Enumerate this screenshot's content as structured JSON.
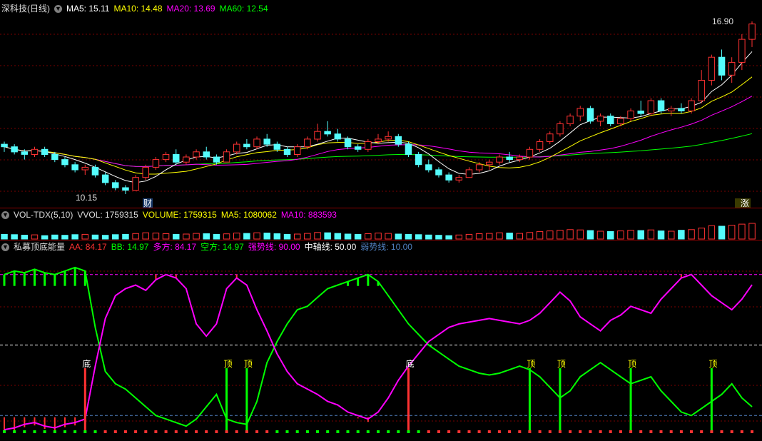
{
  "colors": {
    "up": "#ff3232",
    "down": "#54fcfc",
    "ma5": "#ffffff",
    "ma10": "#ffff00",
    "ma20": "#ff00ff",
    "ma60": "#00ff00",
    "aa": "#ff3232",
    "bb": "#00ff00",
    "duo": "#ff00ff",
    "kong": "#00ff00",
    "strong": "#ff00ff",
    "mid": "#ffffff",
    "weak": "#5080c0"
  },
  "price_panel": {
    "title": "深科技(日线)",
    "icon": "chevron-down-icon",
    "ma5_label": "MA5: 15.11",
    "ma10_label": "MA10: 14.48",
    "ma20_label": "MA20: 13.69",
    "ma60_label": "MA60: 12.54",
    "high_label": "16.90",
    "low_label": "10.15",
    "finance_badge": "财",
    "rise_badge": "涨"
  },
  "volume_panel": {
    "name": "VOL-TDX(5,10)",
    "vvol_label": "VVOL: 1759315",
    "volume_label": "VOLUME: 1759315",
    "ma5_label": "MA5: 1080062",
    "ma10_label": "MA10: 883593"
  },
  "indicator_panel": {
    "name": "私募顶底能量",
    "aa_label": "AA: 84.17",
    "bb_label": "BB: 14.97",
    "duo_label": "多方: 84.17",
    "kong_label": "空方: 14.97",
    "strong_label": "强势线: 90.00",
    "mid_label": "中轴线: 50.00",
    "weak_label": "弱势线: 10.00",
    "top_label": "顶",
    "bottom_label": "底"
  },
  "chart_data": [
    {
      "type": "line",
      "name": "price",
      "candles": [
        [
          12.1,
          12.2,
          11.8,
          12.0
        ],
        [
          12.0,
          12.1,
          11.7,
          11.8
        ],
        [
          11.8,
          11.9,
          11.5,
          11.7
        ],
        [
          11.7,
          12.0,
          11.6,
          11.9
        ],
        [
          11.9,
          12.0,
          11.6,
          11.7
        ],
        [
          11.7,
          11.8,
          11.4,
          11.5
        ],
        [
          11.5,
          11.6,
          11.2,
          11.3
        ],
        [
          11.3,
          11.4,
          11.0,
          11.1
        ],
        [
          11.1,
          11.3,
          10.9,
          11.2
        ],
        [
          11.2,
          11.3,
          10.8,
          10.9
        ],
        [
          10.9,
          11.0,
          10.5,
          10.6
        ],
        [
          10.6,
          10.7,
          10.3,
          10.4
        ],
        [
          10.4,
          10.5,
          10.15,
          10.3
        ],
        [
          10.3,
          10.9,
          10.3,
          10.8
        ],
        [
          10.8,
          11.3,
          10.7,
          11.2
        ],
        [
          11.2,
          11.6,
          11.1,
          11.5
        ],
        [
          11.5,
          11.8,
          11.4,
          11.7
        ],
        [
          11.7,
          11.9,
          11.3,
          11.4
        ],
        [
          11.4,
          11.7,
          11.3,
          11.6
        ],
        [
          11.6,
          11.9,
          11.5,
          11.8
        ],
        [
          11.8,
          12.0,
          11.5,
          11.6
        ],
        [
          11.6,
          11.7,
          11.3,
          11.4
        ],
        [
          11.4,
          11.9,
          11.4,
          11.8
        ],
        [
          11.8,
          12.2,
          11.7,
          12.1
        ],
        [
          12.1,
          12.3,
          11.9,
          12.0
        ],
        [
          12.0,
          12.4,
          11.9,
          12.3
        ],
        [
          12.3,
          12.5,
          12.0,
          12.1
        ],
        [
          12.1,
          12.2,
          11.8,
          11.9
        ],
        [
          11.9,
          12.0,
          11.6,
          11.7
        ],
        [
          11.7,
          12.1,
          11.6,
          12.0
        ],
        [
          12.0,
          12.4,
          11.9,
          12.3
        ],
        [
          12.3,
          12.9,
          12.2,
          12.6
        ],
        [
          12.6,
          13.0,
          12.4,
          12.5
        ],
        [
          12.5,
          12.7,
          12.2,
          12.3
        ],
        [
          12.3,
          12.4,
          11.9,
          12.0
        ],
        [
          12.0,
          12.1,
          11.8,
          11.9
        ],
        [
          11.9,
          12.3,
          11.8,
          12.2
        ],
        [
          12.2,
          12.5,
          12.1,
          12.3
        ],
        [
          12.3,
          12.6,
          12.2,
          12.4
        ],
        [
          12.4,
          12.5,
          12.0,
          12.1
        ],
        [
          12.1,
          12.2,
          11.6,
          11.7
        ],
        [
          11.7,
          11.8,
          11.2,
          11.3
        ],
        [
          11.3,
          11.5,
          11.0,
          11.1
        ],
        [
          11.1,
          11.2,
          10.8,
          10.9
        ],
        [
          10.9,
          11.0,
          10.6,
          10.7
        ],
        [
          10.7,
          10.9,
          10.6,
          10.8
        ],
        [
          10.8,
          11.2,
          10.8,
          11.1
        ],
        [
          11.1,
          11.4,
          11.0,
          11.3
        ],
        [
          11.3,
          11.5,
          11.1,
          11.4
        ],
        [
          11.4,
          11.7,
          11.3,
          11.6
        ],
        [
          11.6,
          11.8,
          11.4,
          11.5
        ],
        [
          11.5,
          11.7,
          11.4,
          11.6
        ],
        [
          11.6,
          12.0,
          11.5,
          11.9
        ],
        [
          11.9,
          12.3,
          11.8,
          12.2
        ],
        [
          12.2,
          12.6,
          12.1,
          12.5
        ],
        [
          12.5,
          13.0,
          12.4,
          12.9
        ],
        [
          12.9,
          13.3,
          12.8,
          13.2
        ],
        [
          13.2,
          13.6,
          13.0,
          13.5
        ],
        [
          13.5,
          13.6,
          12.9,
          13.0
        ],
        [
          13.0,
          13.3,
          12.8,
          13.2
        ],
        [
          13.2,
          13.3,
          12.8,
          12.9
        ],
        [
          12.9,
          13.2,
          12.8,
          13.1
        ],
        [
          13.1,
          13.5,
          13.0,
          13.4
        ],
        [
          13.4,
          13.8,
          13.2,
          13.3
        ],
        [
          13.3,
          13.9,
          13.2,
          13.8
        ],
        [
          13.8,
          13.9,
          13.3,
          13.4
        ],
        [
          13.4,
          13.6,
          13.2,
          13.5
        ],
        [
          13.5,
          13.7,
          13.3,
          13.4
        ],
        [
          13.4,
          13.9,
          13.3,
          13.8
        ],
        [
          13.8,
          15.0,
          13.7,
          14.6
        ],
        [
          14.6,
          15.6,
          14.4,
          15.5
        ],
        [
          15.5,
          15.8,
          14.6,
          14.8
        ],
        [
          14.8,
          15.5,
          14.5,
          15.3
        ],
        [
          15.3,
          16.4,
          15.0,
          16.2
        ],
        [
          16.2,
          16.9,
          15.9,
          16.8
        ]
      ],
      "price_high": 16.9,
      "price_low": 10.15
    },
    {
      "type": "bar",
      "name": "volume",
      "values": [
        30,
        28,
        25,
        27,
        22,
        26,
        24,
        28,
        30,
        26,
        24,
        28,
        30,
        35,
        40,
        38,
        34,
        30,
        32,
        36,
        34,
        30,
        33,
        38,
        36,
        40,
        38,
        34,
        30,
        32,
        36,
        42,
        40,
        36,
        32,
        30,
        34,
        38,
        36,
        32,
        30,
        28,
        26,
        24,
        22,
        26,
        30,
        34,
        36,
        40,
        38,
        36,
        42,
        48,
        52,
        56,
        60,
        58,
        54,
        50,
        48,
        52,
        56,
        54,
        58,
        52,
        50,
        56,
        60,
        70,
        85,
        82,
        88,
        95,
        100
      ]
    },
    {
      "type": "line",
      "name": "energy",
      "ylim": [
        0,
        100
      ],
      "series": [
        {
          "name": "多方",
          "values": [
            2,
            3,
            5,
            6,
            4,
            3,
            5,
            6,
            8,
            38,
            65,
            78,
            82,
            84,
            81,
            87,
            90,
            88,
            82,
            62,
            55,
            62,
            82,
            88,
            84,
            70,
            58,
            45,
            35,
            28,
            25,
            22,
            18,
            16,
            12,
            10,
            8,
            12,
            20,
            30,
            38,
            45,
            52,
            56,
            60,
            62,
            63,
            64,
            65,
            64,
            63,
            62,
            64,
            68,
            74,
            80,
            75,
            66,
            62,
            58,
            64,
            67,
            72,
            70,
            68,
            76,
            82,
            88,
            90,
            84,
            78,
            74,
            70,
            76,
            84.17
          ]
        },
        {
          "name": "空方",
          "values": [
            90,
            92,
            91,
            93,
            91,
            90,
            92,
            94,
            92,
            60,
            35,
            28,
            25,
            20,
            15,
            10,
            8,
            6,
            4,
            8,
            15,
            22,
            8,
            6,
            5,
            18,
            40,
            52,
            62,
            70,
            72,
            77,
            82,
            84,
            86,
            88,
            90,
            86,
            78,
            70,
            62,
            56,
            50,
            46,
            42,
            38,
            36,
            34,
            33,
            34,
            36,
            38,
            36,
            32,
            26,
            20,
            24,
            32,
            36,
            40,
            36,
            32,
            28,
            30,
            32,
            24,
            18,
            12,
            10,
            14,
            18,
            22,
            28,
            20,
            14.97
          ]
        }
      ],
      "top_signals": [
        22,
        24,
        52,
        55,
        62,
        70
      ],
      "bottom_signals": [
        8,
        40
      ]
    }
  ]
}
